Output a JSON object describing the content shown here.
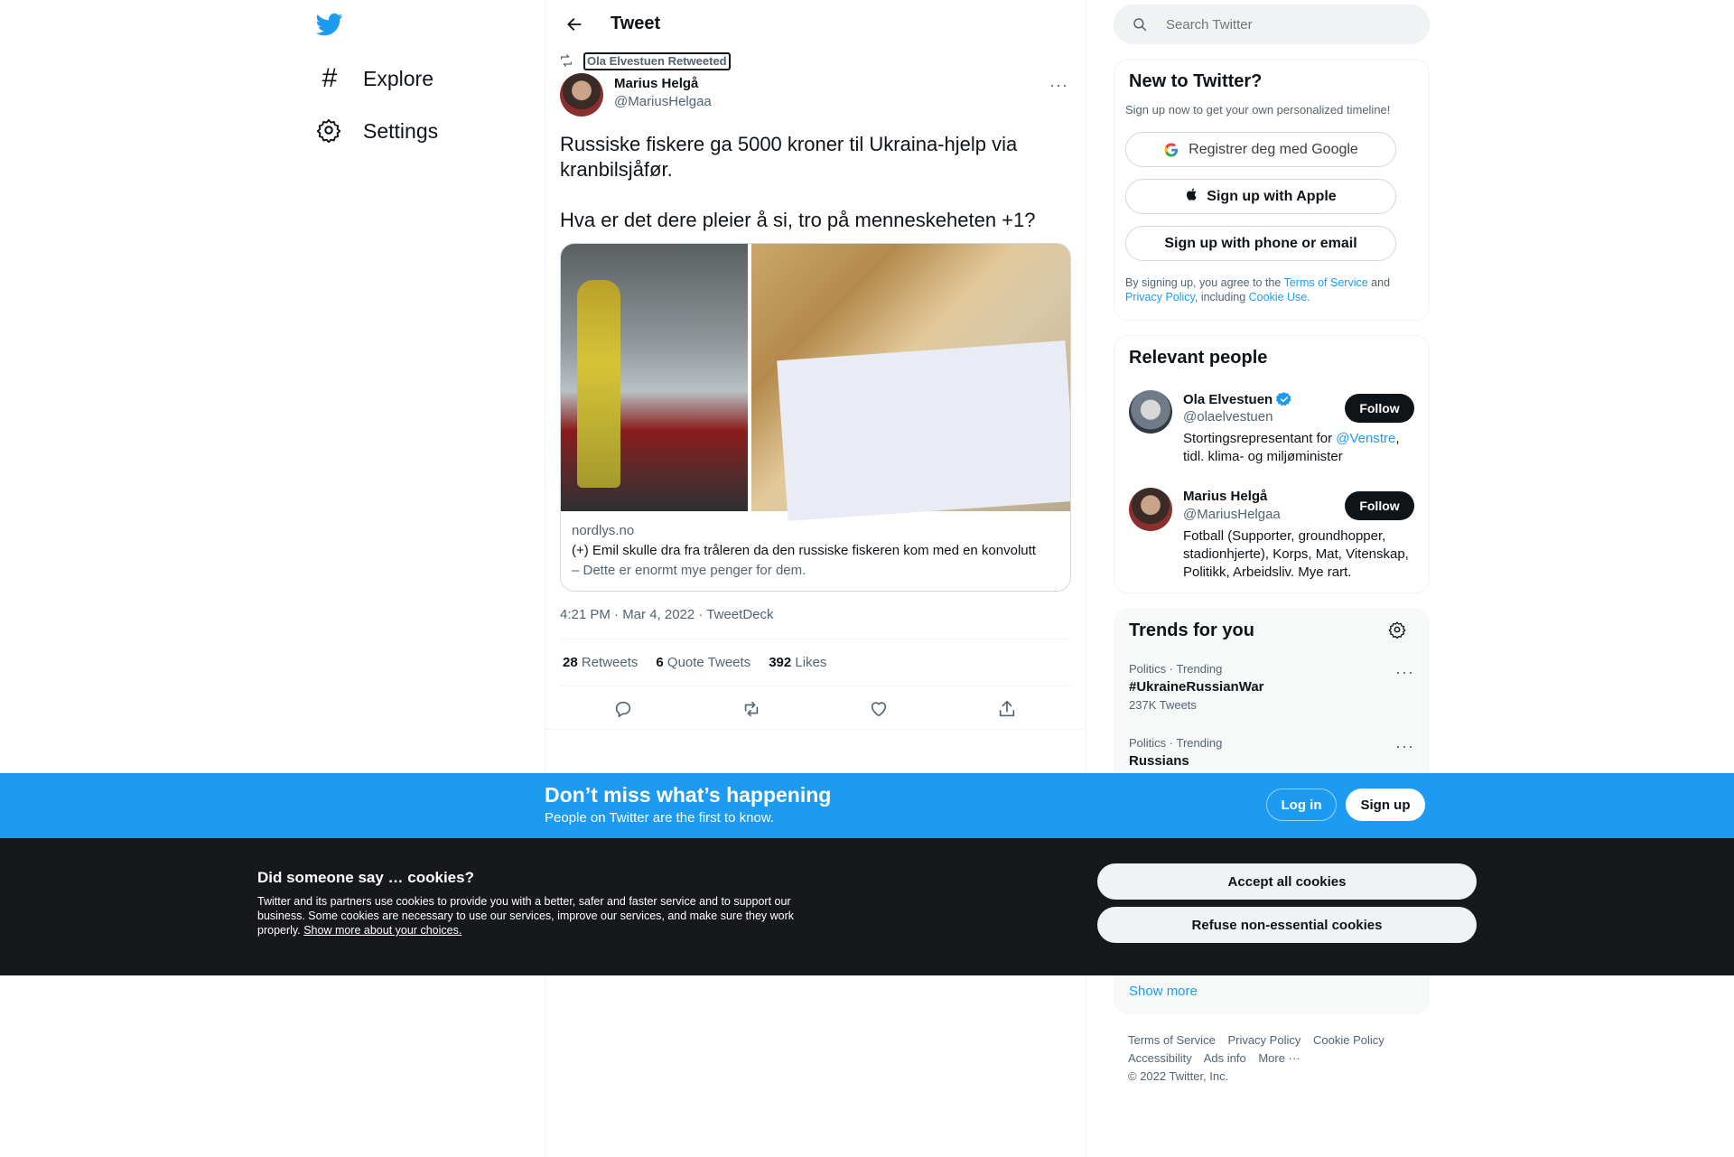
{
  "nav": {
    "explore_label": "Explore",
    "settings_label": "Settings"
  },
  "header": {
    "title": "Tweet"
  },
  "tweet": {
    "social_context": "Ola Elvestuen Retweeted",
    "author_name": "Marius Helgå",
    "author_handle": "@MariusHelgaa",
    "text_line1": "Russiske fiskere ga 5000 kroner til Ukraina-hjelp via kranbilsjåfør.",
    "text_line2": "Hva er det dere pleier å si, tro på menneskeheten +1?",
    "card_domain": "nordlys.no",
    "card_title": "(+) Emil skulle dra fra tråleren da den russiske fiskeren kom med en konvolutt",
    "card_description": "– Dette er enormt mye penger for dem.",
    "timestamp": "4:21 PM · Mar 4, 2022 · TweetDeck",
    "retweets_count": "28",
    "retweets_label": "Retweets",
    "quotes_count": "6",
    "quotes_label": "Quote Tweets",
    "likes_count": "392",
    "likes_label": "Likes"
  },
  "search": {
    "placeholder": "Search Twitter"
  },
  "signup_card": {
    "title": "New to Twitter?",
    "subtitle": "Sign up now to get your own personalized timeline!",
    "google_label": "Registrer deg med Google",
    "apple_label": "Sign up with Apple",
    "phone_label": "Sign up with phone or email",
    "legal_prefix": "By signing up, you agree to the ",
    "terms_link": "Terms of Service",
    "legal_and": " and",
    "privacy_link": "Privacy Policy",
    "legal_including": ", including ",
    "cookie_link": "Cookie Use."
  },
  "relevant_people": {
    "title": "Relevant people",
    "people": [
      {
        "name": "Ola Elvestuen",
        "handle": "@olaelvestuen",
        "bio_prefix": "Stortingsrepresentant for ",
        "bio_mention": "@Venstre",
        "bio_suffix": ",",
        "bio_line2": "tidl. klima- og miljøminister",
        "follow_label": "Follow"
      },
      {
        "name": "Marius Helgå",
        "handle": "@MariusHelgaa",
        "bio_line1": "Fotball (Supporter, groundhopper,",
        "bio_line2": "stadionhjerte), Korps, Mat, Vitenskap,",
        "bio_line3": "Politikk, Arbeidsliv. Mye rart.",
        "follow_label": "Follow"
      }
    ]
  },
  "trends": {
    "title": "Trends for you",
    "items": [
      {
        "meta": "Politics · Trending",
        "name": "#UkraineRussianWar",
        "count": "237K Tweets"
      },
      {
        "meta": "Politics · Trending",
        "name": "Russians"
      }
    ],
    "show_more": "Show more"
  },
  "footer": {
    "links": [
      "Terms of Service",
      "Privacy Policy",
      "Cookie Policy",
      "Accessibility",
      "Ads info",
      "More ···"
    ],
    "copyright": "© 2022 Twitter, Inc."
  },
  "banner": {
    "title": "Don’t miss what’s happening",
    "subtitle": "People on Twitter are the first to know.",
    "login_label": "Log in",
    "signup_label": "Sign up"
  },
  "cookies": {
    "title": "Did someone say … cookies?",
    "body": "Twitter and its partners use cookies to provide you with a better, safer and faster service and to support our business. Some cookies are necessary to use our services, improve our services, and make sure they work properly.",
    "more_link": "Show more about your choices.",
    "accept_label": "Accept all cookies",
    "refuse_label": "Refuse non-essential cookies"
  },
  "colors": {
    "brand": "#1d9bf0",
    "text": "#0f1419",
    "muted": "#536471",
    "cookie_bg": "#16181c"
  }
}
